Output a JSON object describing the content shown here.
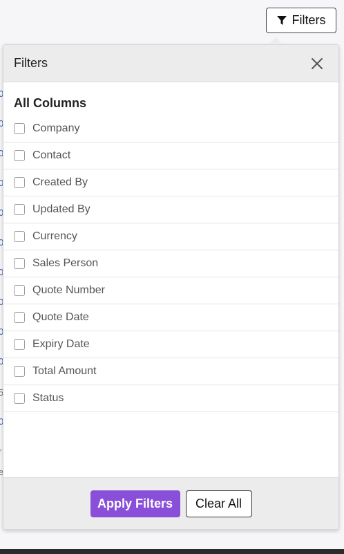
{
  "toolbar": {
    "filters_button_label": "Filters"
  },
  "popover": {
    "title": "Filters",
    "section_title": "All Columns",
    "columns": [
      {
        "label": "Company",
        "checked": false
      },
      {
        "label": "Contact",
        "checked": false
      },
      {
        "label": "Created By",
        "checked": false
      },
      {
        "label": "Updated By",
        "checked": false
      },
      {
        "label": "Currency",
        "checked": false
      },
      {
        "label": "Sales Person",
        "checked": false
      },
      {
        "label": "Quote Number",
        "checked": false
      },
      {
        "label": "Quote Date",
        "checked": false
      },
      {
        "label": "Expiry Date",
        "checked": false
      },
      {
        "label": "Total Amount",
        "checked": false
      },
      {
        "label": "Status",
        "checked": false
      }
    ],
    "apply_label": "Apply Filters",
    "clear_label": "Clear All"
  },
  "colors": {
    "accent": "#8a4fd8",
    "header_bg": "#ececec",
    "link_blue": "#3a5fae"
  },
  "icons": {
    "filter": "funnel-icon",
    "close": "close-icon"
  }
}
